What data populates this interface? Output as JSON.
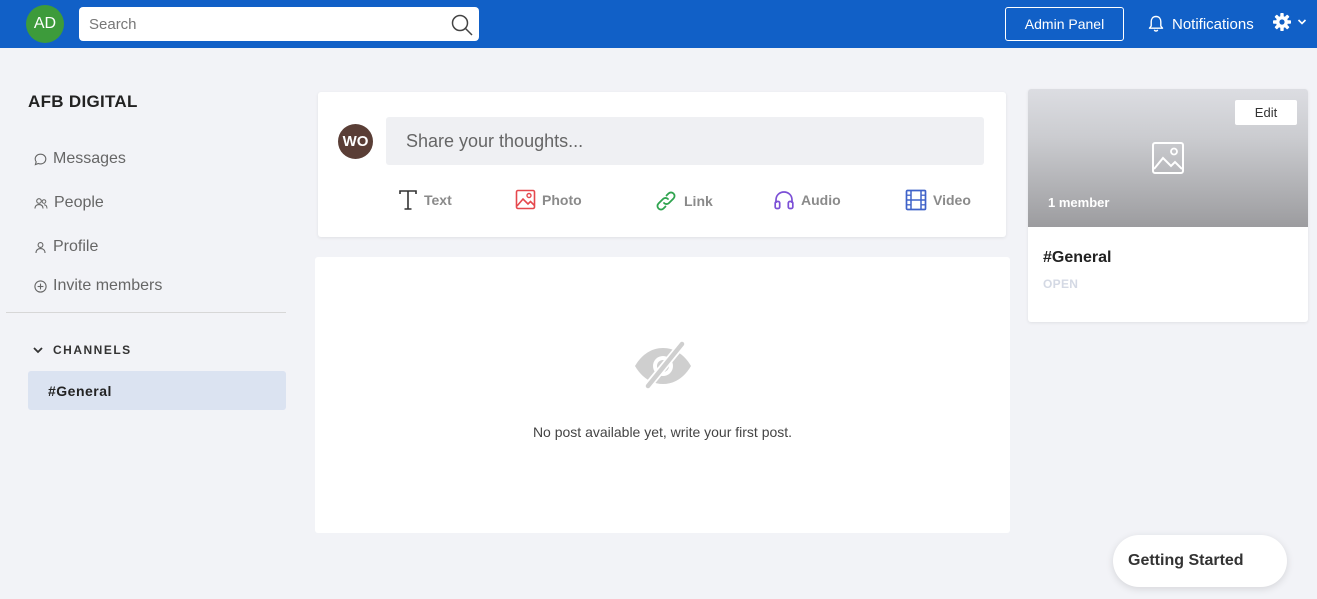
{
  "header": {
    "user_initials": "AD",
    "search_placeholder": "Search",
    "admin_label": "Admin Panel",
    "notifications_label": "Notifications"
  },
  "sidebar": {
    "brand": "AFB DIGITAL",
    "items": [
      {
        "label": "Messages",
        "icon": "chat-bubble-icon"
      },
      {
        "label": "People",
        "icon": "people-icon"
      },
      {
        "label": "Profile",
        "icon": "person-icon"
      },
      {
        "label": "Invite members",
        "icon": "plus-circle-icon"
      }
    ],
    "channels_heading": "CHANNELS",
    "channels": [
      "#General"
    ]
  },
  "composer": {
    "user_initials": "WO",
    "placeholder": "Share your thoughts...",
    "post_types": [
      {
        "label": "Text",
        "icon": "text-icon",
        "color": "#333333"
      },
      {
        "label": "Photo",
        "icon": "photo-icon",
        "color": "#e5484d"
      },
      {
        "label": "Link",
        "icon": "link-icon",
        "color": "#2fa44f"
      },
      {
        "label": "Audio",
        "icon": "headphones-icon",
        "color": "#7b4fd6"
      },
      {
        "label": "Video",
        "icon": "film-icon",
        "color": "#3f62c9"
      }
    ]
  },
  "feed": {
    "empty_message": "No post available yet, write your first post."
  },
  "channel_card": {
    "edit_label": "Edit",
    "member_count": "1 member",
    "title": "#General",
    "status": "OPEN"
  },
  "getting_started_label": "Getting Started",
  "colors": {
    "topbar": "#1160c7",
    "avatar_green": "#3d9b3b",
    "avatar_brown": "#5a3e36",
    "active_channel_bg": "#dbe3f1"
  }
}
